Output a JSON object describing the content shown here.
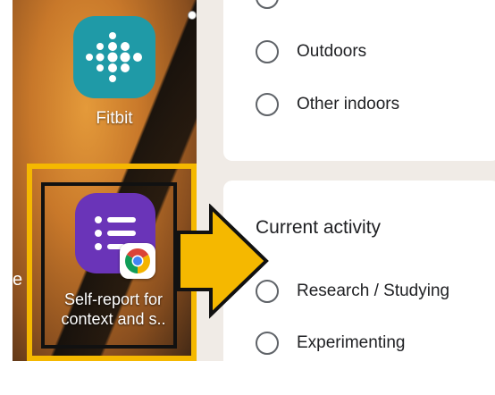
{
  "home": {
    "edge_letter": "e",
    "fitbit_label": "Fitbit",
    "selfreport_label_line1": "Self-report for",
    "selfreport_label_line2": "context and s..",
    "colors": {
      "highlight": "#f5b800",
      "fitbit_bg": "#1f9aa7",
      "selfreport_bg": "#6a34b8"
    }
  },
  "form": {
    "location_options": [
      "Outdoors",
      "Other indoors"
    ],
    "activity_question": "Current activity",
    "activity_options": [
      "Research / Studying",
      "Experimenting"
    ]
  }
}
